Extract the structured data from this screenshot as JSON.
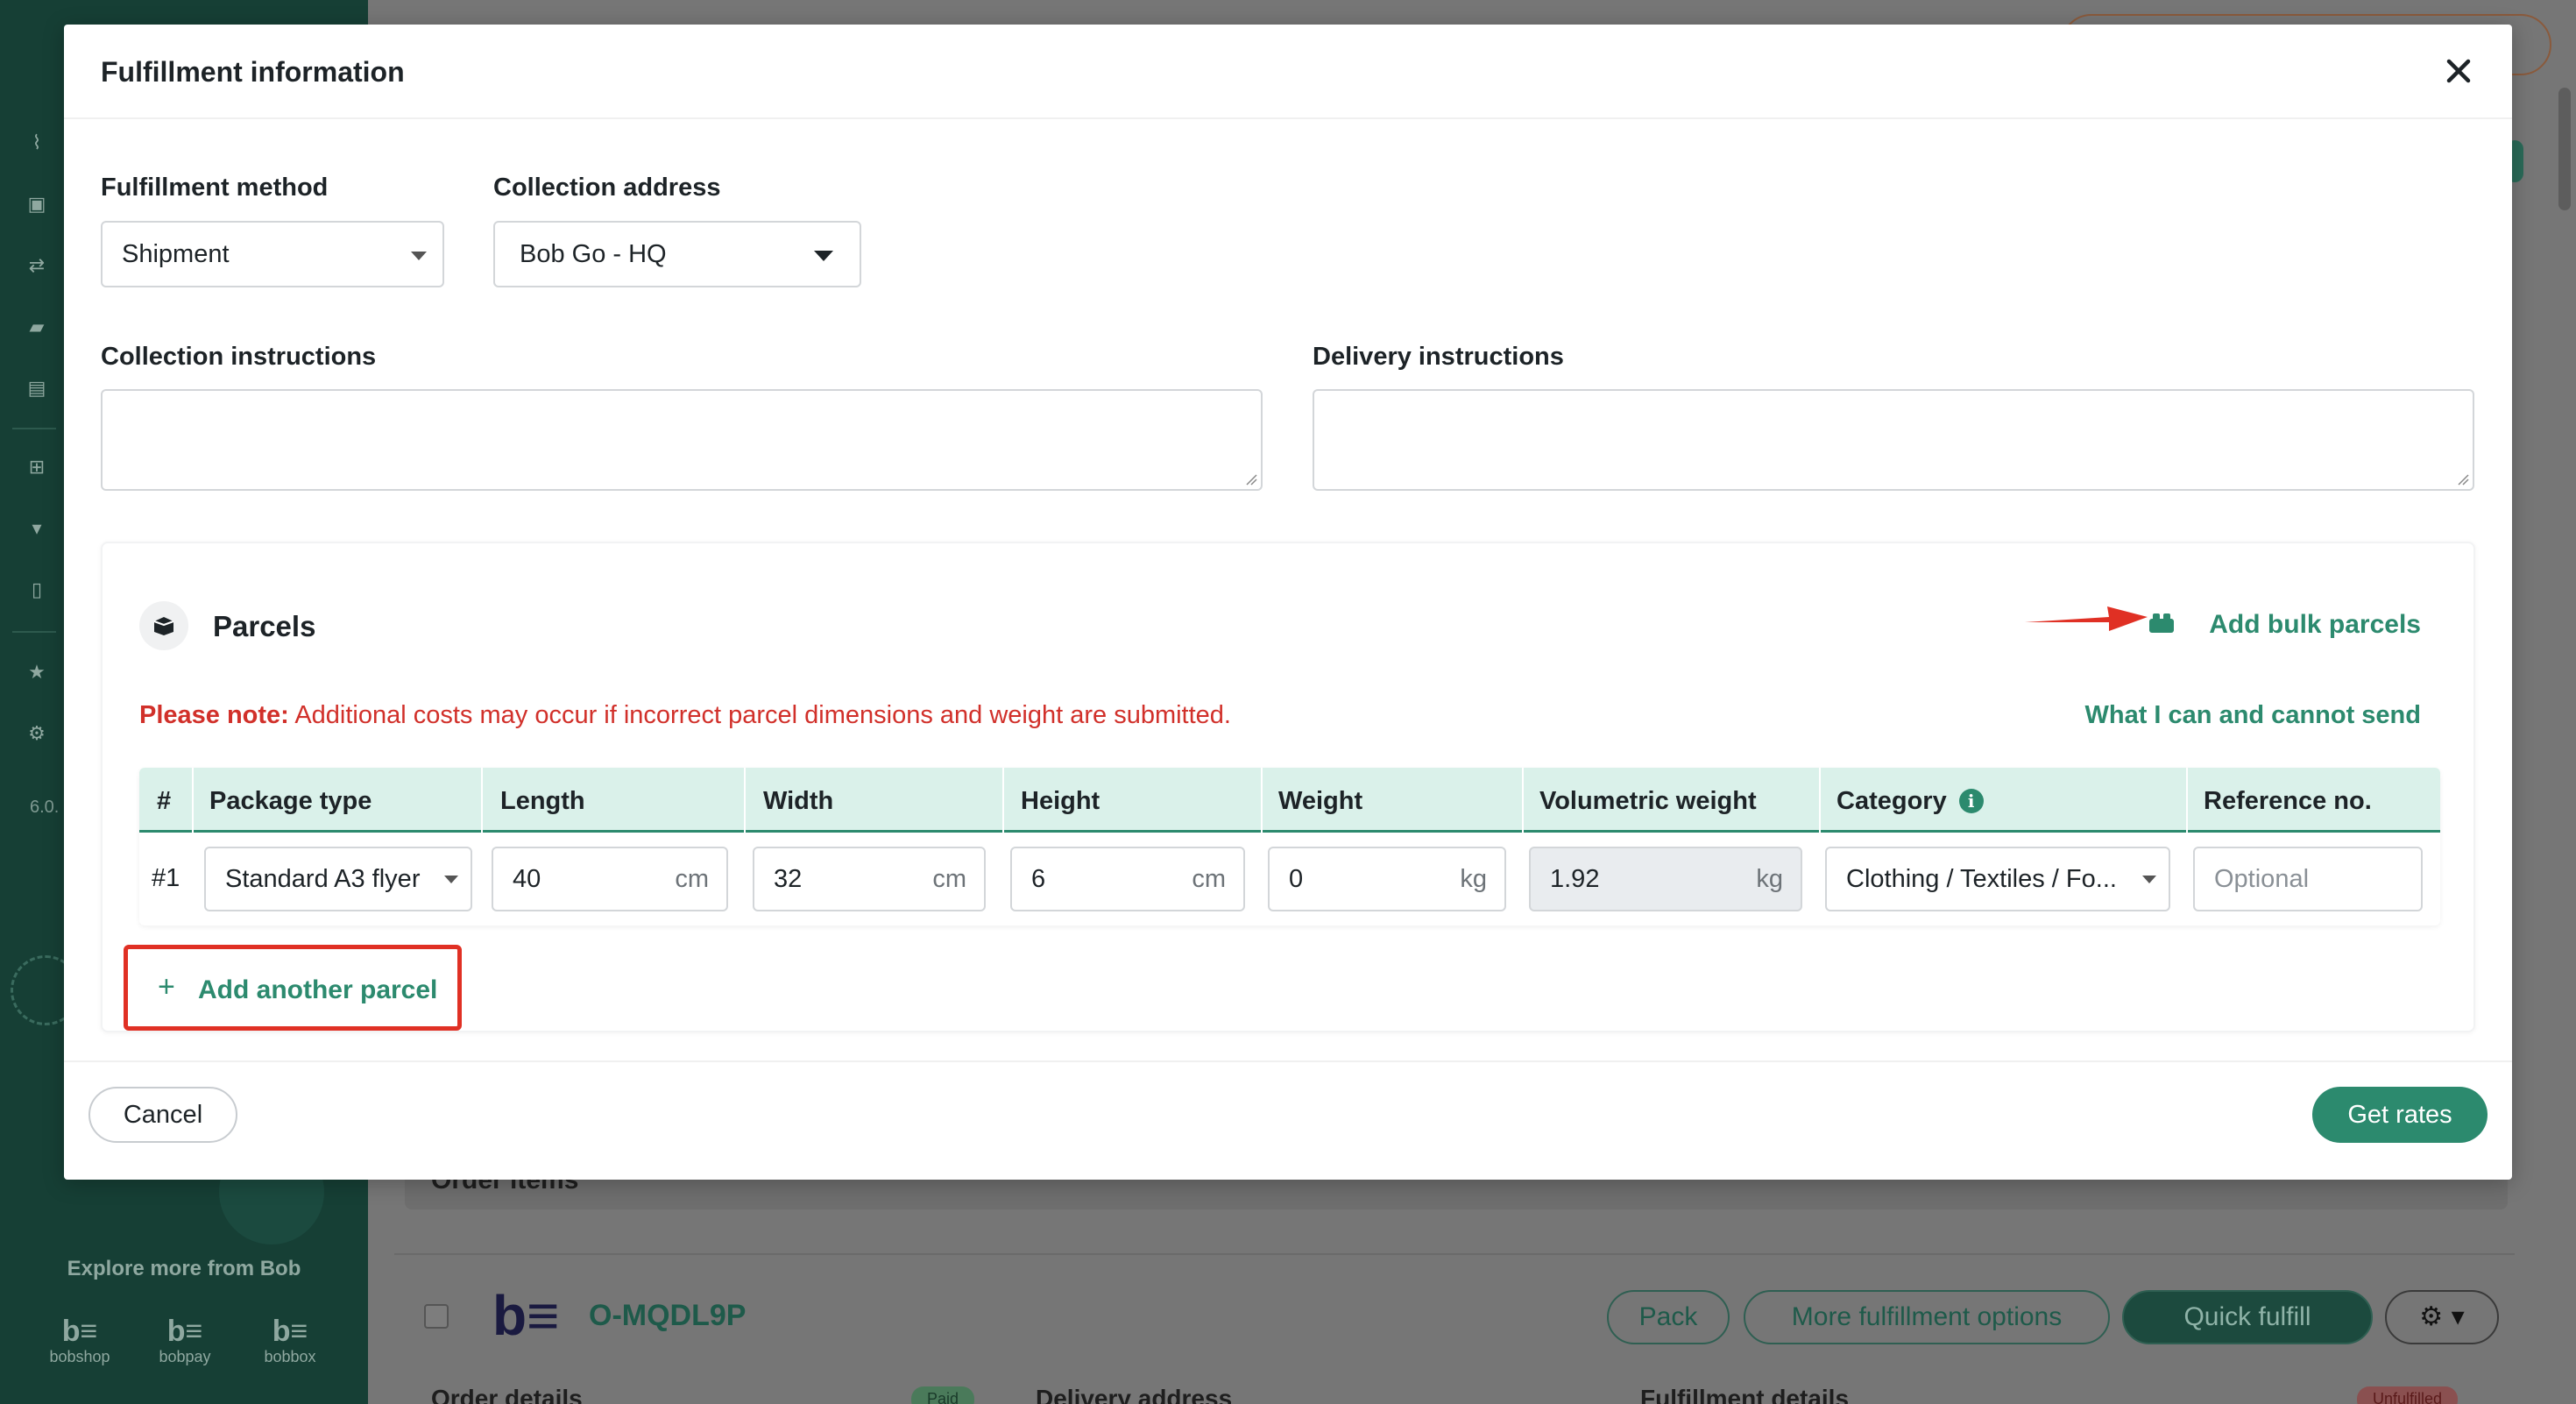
{
  "modal": {
    "title": "Fulfillment information"
  },
  "form": {
    "fulfillment_method_label": "Fulfillment method",
    "fulfillment_method_value": "Shipment",
    "collection_address_label": "Collection address",
    "collection_address_value": "Bob Go - HQ",
    "collection_instructions_label": "Collection instructions",
    "delivery_instructions_label": "Delivery instructions"
  },
  "parcels": {
    "title": "Parcels",
    "bulk_link": "Add bulk parcels",
    "note_bold": "Please note:",
    "note_text": "Additional costs may occur if incorrect parcel dimensions and weight are submitted.",
    "send_link": "What I can and cannot send",
    "columns": [
      "#",
      "Package type",
      "Length",
      "Width",
      "Height",
      "Weight",
      "Volumetric weight",
      "Category",
      "Reference no."
    ],
    "rows": [
      {
        "num": "#1",
        "package_type": "Standard A3 flyer",
        "length": "40",
        "length_unit": "cm",
        "width": "32",
        "width_unit": "cm",
        "height": "6",
        "height_unit": "cm",
        "weight": "0",
        "weight_unit": "kg",
        "volumetric": "1.92",
        "volumetric_unit": "kg",
        "category": "Clothing / Textiles / Fo...",
        "reference_placeholder": "Optional"
      }
    ],
    "add_parcel": "Add another parcel"
  },
  "footer": {
    "cancel": "Cancel",
    "get_rates": "Get rates"
  },
  "background": {
    "sidebar_version": "6.0.",
    "explore": "Explore more from Bob",
    "brands": [
      "bobshop",
      "bobpay",
      "bobbox"
    ],
    "order_items": "Order items",
    "order_id": "O-MQDL9P",
    "buttons": [
      "Pack",
      "More fulfillment options",
      "Quick fulfill"
    ],
    "subheads": [
      "Order details",
      "Delivery address",
      "Fulfillment details"
    ],
    "badges": [
      "Paid",
      "Unfulfilled"
    ]
  },
  "colors": {
    "accent": "#2c8a6e",
    "warning": "#d1302a",
    "header_bg": "#daf1ea",
    "sidebar": "#163f35"
  }
}
